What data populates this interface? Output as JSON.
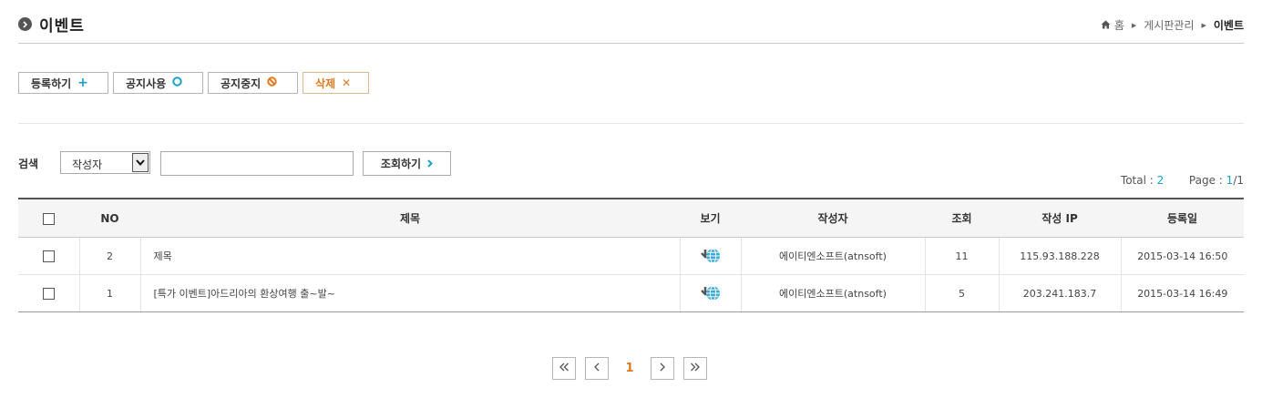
{
  "header": {
    "title": "이벤트",
    "breadcrumb": {
      "home": "홈",
      "section": "게시판관리",
      "current": "이벤트"
    }
  },
  "toolbar": {
    "register_label": "등록하기",
    "notice_on_label": "공지사용",
    "notice_off_label": "공지중지",
    "delete_label": "삭제"
  },
  "search": {
    "label": "검색",
    "field_selected": "작성자",
    "query_value": "",
    "submit_label": "조회하기"
  },
  "stats": {
    "total_label": "Total :",
    "total": "2",
    "page_label": "Page :",
    "page_current": "1",
    "page_total": "/1"
  },
  "table": {
    "columns": [
      "NO",
      "제목",
      "보기",
      "작성자",
      "조회",
      "작성 IP",
      "등록일"
    ],
    "rows": [
      {
        "no": "2",
        "subject": "제목",
        "author": "에이티엔소프트(atnsoft)",
        "views": "11",
        "ip": "115.93.188.228",
        "date": "2015-03-14 16:50"
      },
      {
        "no": "1",
        "subject": "[특가 이벤트]아드리아의 환상여행 출~발~",
        "author": "에이티엔소프트(atnsoft)",
        "views": "5",
        "ip": "203.241.183.7",
        "date": "2015-03-14 16:49"
      }
    ]
  },
  "pagination": {
    "current": "1"
  },
  "colors": {
    "accent_blue": "#1ba1c5",
    "accent_orange": "#e07a1f"
  }
}
